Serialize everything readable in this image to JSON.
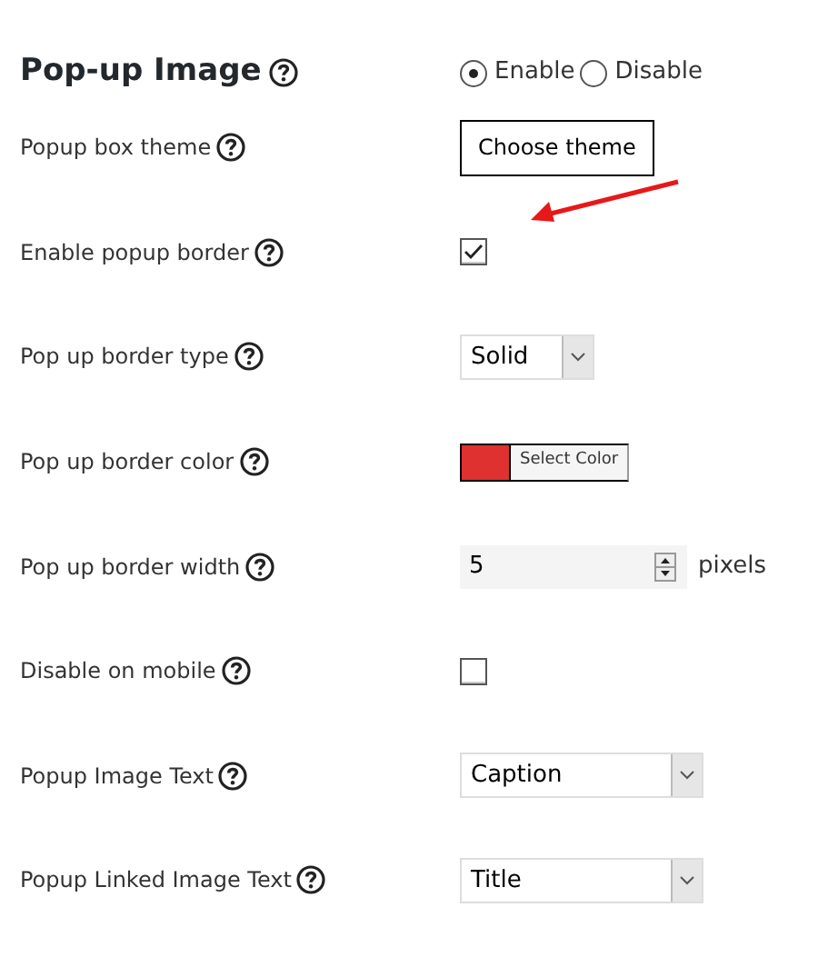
{
  "heading": {
    "title": "Pop-up Image",
    "options": [
      {
        "label": "Enable",
        "selected": true
      },
      {
        "label": "Disable",
        "selected": false
      }
    ]
  },
  "rows": [
    {
      "label": "Popup box theme",
      "kind": "button",
      "text": "Choose theme"
    },
    {
      "label": "Enable popup border",
      "kind": "checkbox",
      "checked": true,
      "annotated": true
    },
    {
      "label": "Pop up border type",
      "kind": "short-select",
      "value": "Solid"
    },
    {
      "label": "Pop up border color",
      "kind": "color",
      "color": "#e03131",
      "text": "Select Color"
    },
    {
      "label": "Pop up border width",
      "kind": "number",
      "value": "5",
      "unit": "pixels"
    },
    {
      "label": "Disable on mobile",
      "kind": "checkbox",
      "checked": false
    },
    {
      "label": "Popup Image Text",
      "kind": "select",
      "value": "Caption"
    },
    {
      "label": "Popup Linked Image Text",
      "kind": "select",
      "value": "Title"
    }
  ]
}
